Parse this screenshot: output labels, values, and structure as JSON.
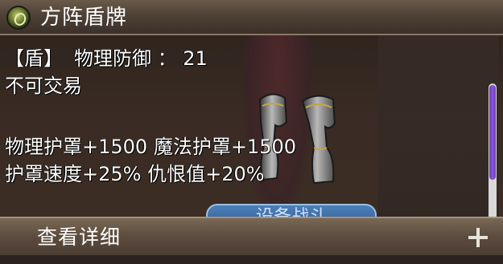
{
  "title_bar": {
    "title": "方阵盾牌",
    "icon": "item-quality-orb-icon"
  },
  "item_info": {
    "type_tag": "【盾】",
    "stat_label": "物理防御 ：",
    "stat_value": "21",
    "trade_status": "不可交易",
    "bonus_line_1": "物理护罩+1500 魔法护罩+1500",
    "bonus_line_2": "护罩速度+25% 仇恨值+20%"
  },
  "background_button": {
    "label": "设备战斗"
  },
  "footer": {
    "label": "查看详细",
    "expand_icon": "plus-icon"
  },
  "colors": {
    "scroll_thumb": "#8a55d8",
    "text": "#ffffff",
    "panel_brown": "#5b4c3e"
  }
}
